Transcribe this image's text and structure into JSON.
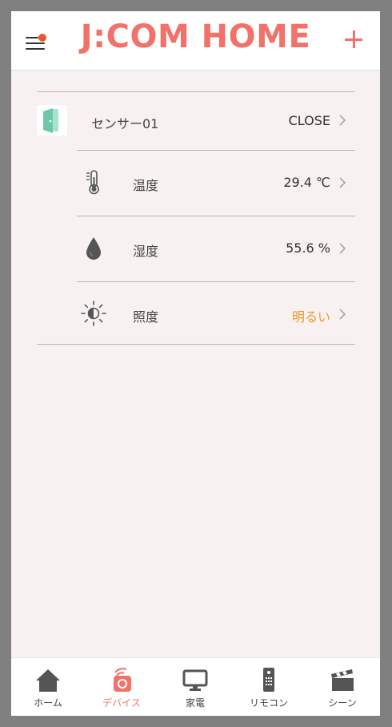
{
  "header": {
    "logo_text": "J:COM HOME",
    "menu_icon": "menu-icon",
    "add_icon": "plus-icon"
  },
  "device": {
    "name": "センサー01",
    "status": "CLOSE",
    "icon": "door-open-icon"
  },
  "readings": [
    {
      "icon": "thermometer-icon",
      "label": "温度",
      "value": "29.4 ℃"
    },
    {
      "icon": "water-drop-icon",
      "label": "湿度",
      "value": "55.6 %"
    },
    {
      "icon": "brightness-icon",
      "label": "照度",
      "value": "明るい"
    }
  ],
  "tabs": [
    {
      "label": "ホーム",
      "icon": "home-icon"
    },
    {
      "label": "デバイス",
      "icon": "device-icon",
      "active": true
    },
    {
      "label": "家電",
      "icon": "monitor-icon"
    },
    {
      "label": "リモコン",
      "icon": "remote-icon"
    },
    {
      "label": "シーン",
      "icon": "clapperboard-icon"
    }
  ],
  "colors": {
    "accent": "#f27168",
    "notification_dot": "#e8582f",
    "bright_value": "#eb9a2a",
    "door_icon": "#6cc9a8",
    "background": "#f7f2f1"
  }
}
